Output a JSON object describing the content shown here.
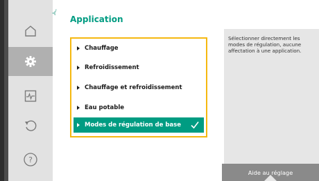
{
  "screen": {
    "title": "Application",
    "menu": {
      "items": [
        {
          "label": "Chauffage",
          "selected": false
        },
        {
          "label": "Refroidissement",
          "selected": false
        },
        {
          "label": "Chauffage et refroidissement",
          "selected": false
        },
        {
          "label": "Eau potable",
          "selected": false
        },
        {
          "label": "Modes de régulation de base",
          "selected": true
        }
      ]
    },
    "help": {
      "text": "Sélectionner directement les modes de régulation, aucune affectation à une application.",
      "button_label": "Aide au réglage"
    }
  },
  "sidebar": {
    "items": [
      {
        "icon": "home-icon",
        "active": false
      },
      {
        "icon": "gear-icon",
        "active": true
      },
      {
        "icon": "diagnostics-icon",
        "active": false
      },
      {
        "icon": "restore-icon",
        "active": false
      },
      {
        "icon": "help-icon",
        "active": false
      }
    ]
  },
  "colors": {
    "accent": "#009c82",
    "focus_frame": "#f5b80f",
    "sidebar_bg": "#e2e2e2",
    "sidebar_active": "#b0b0b0",
    "help_bg": "#e6e6e6",
    "help_bar": "#8a8a8a"
  }
}
